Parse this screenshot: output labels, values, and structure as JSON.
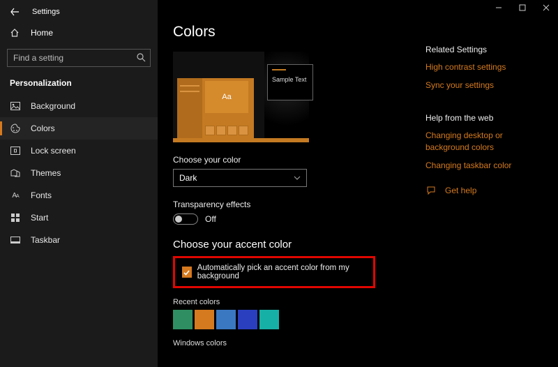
{
  "window": {
    "title": "Settings"
  },
  "sidebar": {
    "home": "Home",
    "search_placeholder": "Find a setting",
    "category": "Personalization",
    "items": [
      {
        "label": "Background"
      },
      {
        "label": "Colors"
      },
      {
        "label": "Lock screen"
      },
      {
        "label": "Themes"
      },
      {
        "label": "Fonts"
      },
      {
        "label": "Start"
      },
      {
        "label": "Taskbar"
      }
    ]
  },
  "page": {
    "title": "Colors",
    "sample_text": "Sample Text",
    "choose_color_label": "Choose your color",
    "choose_color_value": "Dark",
    "transparency_label": "Transparency effects",
    "transparency_state": "Off",
    "accent_heading": "Choose your accent color",
    "auto_pick_label": "Automatically pick an accent color from my background",
    "recent_label": "Recent colors",
    "recent_colors": [
      "#2f8f62",
      "#d57a1f",
      "#3a78c2",
      "#2a3fbf",
      "#17b0a6"
    ],
    "windows_colors_label": "Windows colors"
  },
  "right": {
    "related_heading": "Related Settings",
    "link_contrast": "High contrast settings",
    "link_sync": "Sync your settings",
    "help_heading": "Help from the web",
    "link_bg": "Changing desktop or background colors",
    "link_taskbar": "Changing taskbar color",
    "get_help": "Get help"
  }
}
